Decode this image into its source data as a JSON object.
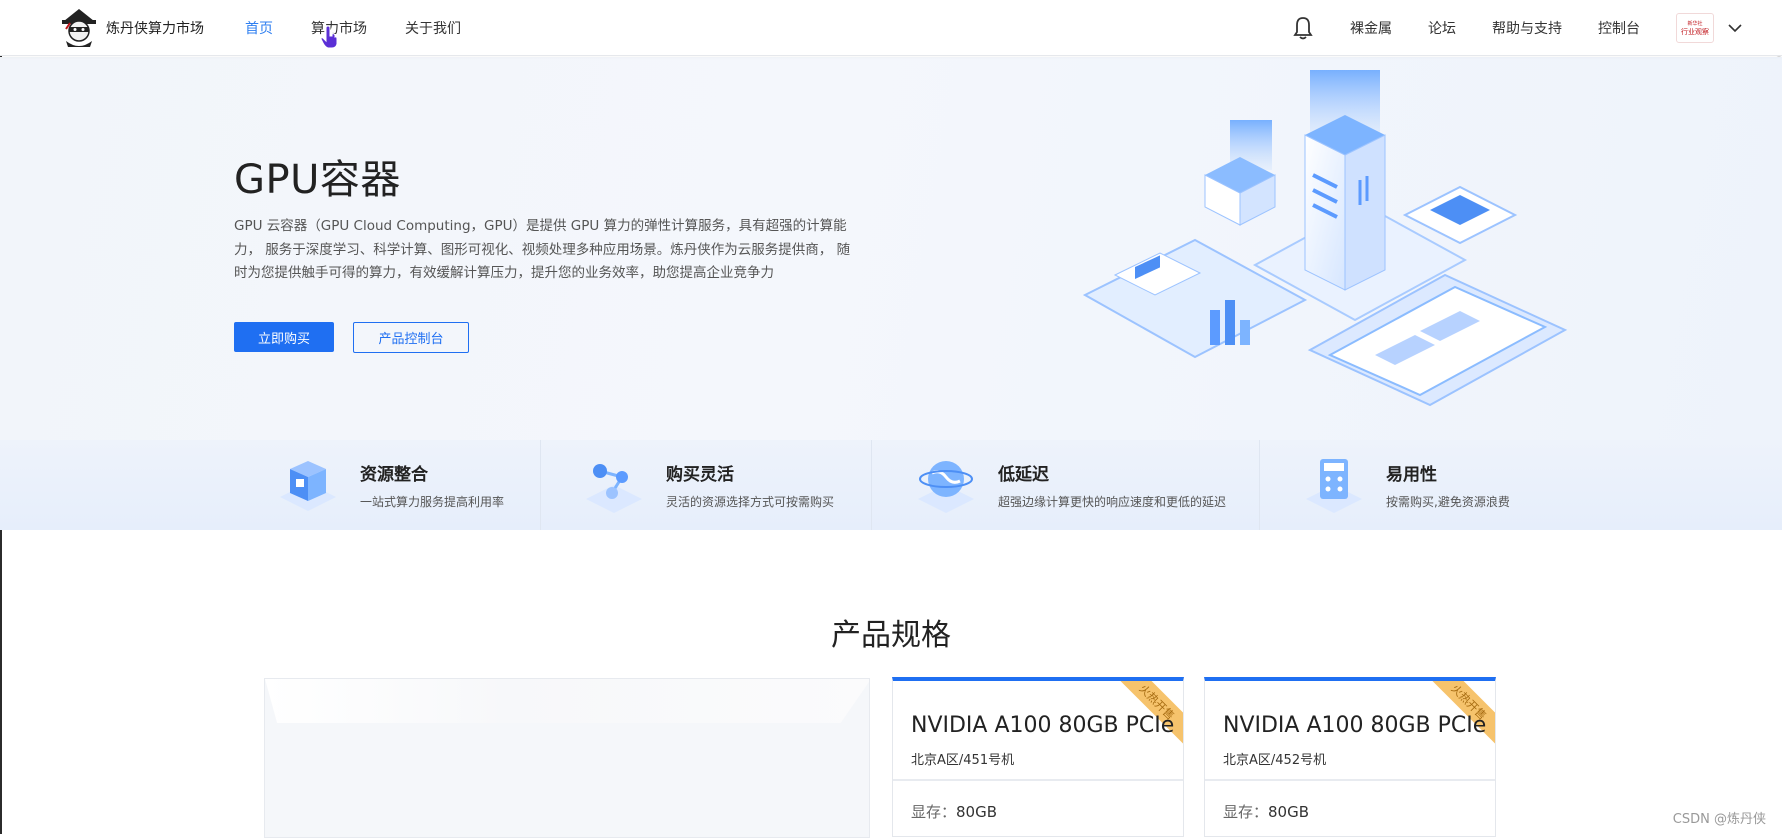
{
  "brand": {
    "name": "炼丹侠算力市场"
  },
  "nav": {
    "items": [
      {
        "label": "首页",
        "active": true
      },
      {
        "label": "算力市场",
        "active": false
      },
      {
        "label": "关于我们",
        "active": false
      }
    ]
  },
  "rightnav": {
    "items": [
      "裸金属",
      "论坛",
      "帮助与支持",
      "控制台"
    ],
    "avatar": {
      "line1": "行业观察",
      "line2": "新华社"
    }
  },
  "hero": {
    "title": "GPU容器",
    "description": "GPU 云容器（GPU Cloud Computing，GPU）是提供 GPU 算力的弹性计算服务，具有超强的计算能力， 服务于深度学习、科学计算、图形可视化、视频处理多种应用场景。炼丹侠作为云服务提供商， 随时为您提供触手可得的算力，有效缓解计算压力，提升您的业务效率，助您提高企业竞争力",
    "buy_label": "立即购买",
    "console_label": "产品控制台"
  },
  "features": [
    {
      "title": "资源整合",
      "desc": "一站式算力服务提高利用率",
      "icon": "cube-chip-icon"
    },
    {
      "title": "购买灵活",
      "desc": "灵活的资源选择方式可按需购买",
      "icon": "network-nodes-icon"
    },
    {
      "title": "低延迟",
      "desc": "超强边缘计算更快的响应速度和更低的延迟",
      "icon": "globe-icon"
    },
    {
      "title": "易用性",
      "desc": "按需购买,避免资源浪费",
      "icon": "calculator-icon"
    }
  ],
  "specs": {
    "title": "产品规格",
    "products": [
      {
        "name": "NVIDIA A100 80GB PCIe",
        "location": "北京A区/451号机",
        "mem_label": "显存：",
        "mem_value": "80GB",
        "badge": "火热开售"
      },
      {
        "name": "NVIDIA A100 80GB PCIe",
        "location": "北京A区/452号机",
        "mem_label": "显存：",
        "mem_value": "80GB",
        "badge": "火热开售"
      }
    ]
  },
  "watermark": "CSDN @炼丹侠",
  "colors": {
    "accent": "#1f6ff2",
    "ribbon": "#f6c36c"
  }
}
